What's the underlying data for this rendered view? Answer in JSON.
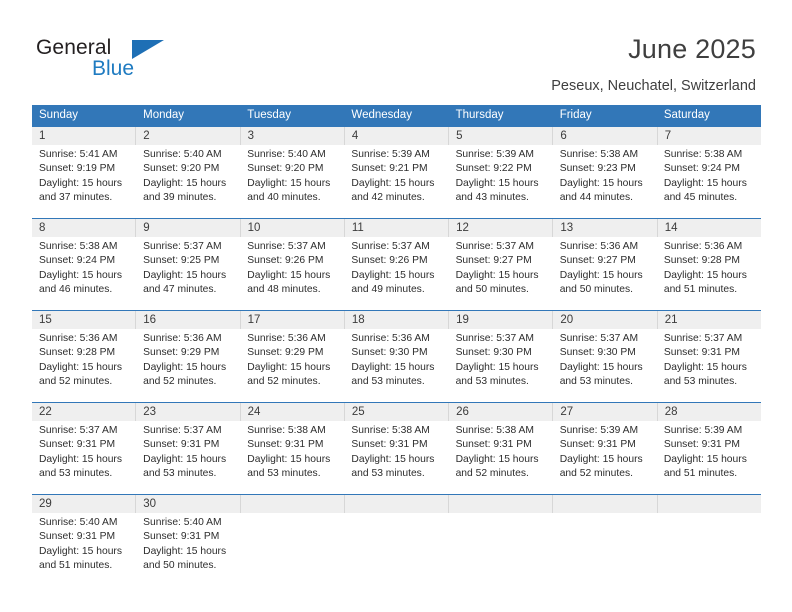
{
  "brand": {
    "name_top": "General",
    "name_bottom": "Blue",
    "triangle_color": "#1e6fb5",
    "blue_color": "#1f7bc1"
  },
  "header": {
    "title": "June 2025",
    "subtitle": "Peseux, Neuchatel, Switzerland"
  },
  "theme": {
    "header_blue": "#3277b8",
    "daynum_band": "#efefef",
    "text": "#2d2d2d"
  },
  "weekdays": [
    "Sunday",
    "Monday",
    "Tuesday",
    "Wednesday",
    "Thursday",
    "Friday",
    "Saturday"
  ],
  "weeks": [
    {
      "days": [
        {
          "num": "1",
          "info": "Sunrise: 5:41 AM\nSunset: 9:19 PM\nDaylight: 15 hours and 37 minutes."
        },
        {
          "num": "2",
          "info": "Sunrise: 5:40 AM\nSunset: 9:20 PM\nDaylight: 15 hours and 39 minutes."
        },
        {
          "num": "3",
          "info": "Sunrise: 5:40 AM\nSunset: 9:20 PM\nDaylight: 15 hours and 40 minutes."
        },
        {
          "num": "4",
          "info": "Sunrise: 5:39 AM\nSunset: 9:21 PM\nDaylight: 15 hours and 42 minutes."
        },
        {
          "num": "5",
          "info": "Sunrise: 5:39 AM\nSunset: 9:22 PM\nDaylight: 15 hours and 43 minutes."
        },
        {
          "num": "6",
          "info": "Sunrise: 5:38 AM\nSunset: 9:23 PM\nDaylight: 15 hours and 44 minutes."
        },
        {
          "num": "7",
          "info": "Sunrise: 5:38 AM\nSunset: 9:24 PM\nDaylight: 15 hours and 45 minutes."
        }
      ]
    },
    {
      "days": [
        {
          "num": "8",
          "info": "Sunrise: 5:38 AM\nSunset: 9:24 PM\nDaylight: 15 hours and 46 minutes."
        },
        {
          "num": "9",
          "info": "Sunrise: 5:37 AM\nSunset: 9:25 PM\nDaylight: 15 hours and 47 minutes."
        },
        {
          "num": "10",
          "info": "Sunrise: 5:37 AM\nSunset: 9:26 PM\nDaylight: 15 hours and 48 minutes."
        },
        {
          "num": "11",
          "info": "Sunrise: 5:37 AM\nSunset: 9:26 PM\nDaylight: 15 hours and 49 minutes."
        },
        {
          "num": "12",
          "info": "Sunrise: 5:37 AM\nSunset: 9:27 PM\nDaylight: 15 hours and 50 minutes."
        },
        {
          "num": "13",
          "info": "Sunrise: 5:36 AM\nSunset: 9:27 PM\nDaylight: 15 hours and 50 minutes."
        },
        {
          "num": "14",
          "info": "Sunrise: 5:36 AM\nSunset: 9:28 PM\nDaylight: 15 hours and 51 minutes."
        }
      ]
    },
    {
      "days": [
        {
          "num": "15",
          "info": "Sunrise: 5:36 AM\nSunset: 9:28 PM\nDaylight: 15 hours and 52 minutes."
        },
        {
          "num": "16",
          "info": "Sunrise: 5:36 AM\nSunset: 9:29 PM\nDaylight: 15 hours and 52 minutes."
        },
        {
          "num": "17",
          "info": "Sunrise: 5:36 AM\nSunset: 9:29 PM\nDaylight: 15 hours and 52 minutes."
        },
        {
          "num": "18",
          "info": "Sunrise: 5:36 AM\nSunset: 9:30 PM\nDaylight: 15 hours and 53 minutes."
        },
        {
          "num": "19",
          "info": "Sunrise: 5:37 AM\nSunset: 9:30 PM\nDaylight: 15 hours and 53 minutes."
        },
        {
          "num": "20",
          "info": "Sunrise: 5:37 AM\nSunset: 9:30 PM\nDaylight: 15 hours and 53 minutes."
        },
        {
          "num": "21",
          "info": "Sunrise: 5:37 AM\nSunset: 9:31 PM\nDaylight: 15 hours and 53 minutes."
        }
      ]
    },
    {
      "days": [
        {
          "num": "22",
          "info": "Sunrise: 5:37 AM\nSunset: 9:31 PM\nDaylight: 15 hours and 53 minutes."
        },
        {
          "num": "23",
          "info": "Sunrise: 5:37 AM\nSunset: 9:31 PM\nDaylight: 15 hours and 53 minutes."
        },
        {
          "num": "24",
          "info": "Sunrise: 5:38 AM\nSunset: 9:31 PM\nDaylight: 15 hours and 53 minutes."
        },
        {
          "num": "25",
          "info": "Sunrise: 5:38 AM\nSunset: 9:31 PM\nDaylight: 15 hours and 53 minutes."
        },
        {
          "num": "26",
          "info": "Sunrise: 5:38 AM\nSunset: 9:31 PM\nDaylight: 15 hours and 52 minutes."
        },
        {
          "num": "27",
          "info": "Sunrise: 5:39 AM\nSunset: 9:31 PM\nDaylight: 15 hours and 52 minutes."
        },
        {
          "num": "28",
          "info": "Sunrise: 5:39 AM\nSunset: 9:31 PM\nDaylight: 15 hours and 51 minutes."
        }
      ]
    },
    {
      "days": [
        {
          "num": "29",
          "info": "Sunrise: 5:40 AM\nSunset: 9:31 PM\nDaylight: 15 hours and 51 minutes."
        },
        {
          "num": "30",
          "info": "Sunrise: 5:40 AM\nSunset: 9:31 PM\nDaylight: 15 hours and 50 minutes."
        },
        {
          "num": "",
          "info": ""
        },
        {
          "num": "",
          "info": ""
        },
        {
          "num": "",
          "info": ""
        },
        {
          "num": "",
          "info": ""
        },
        {
          "num": "",
          "info": ""
        }
      ]
    }
  ]
}
